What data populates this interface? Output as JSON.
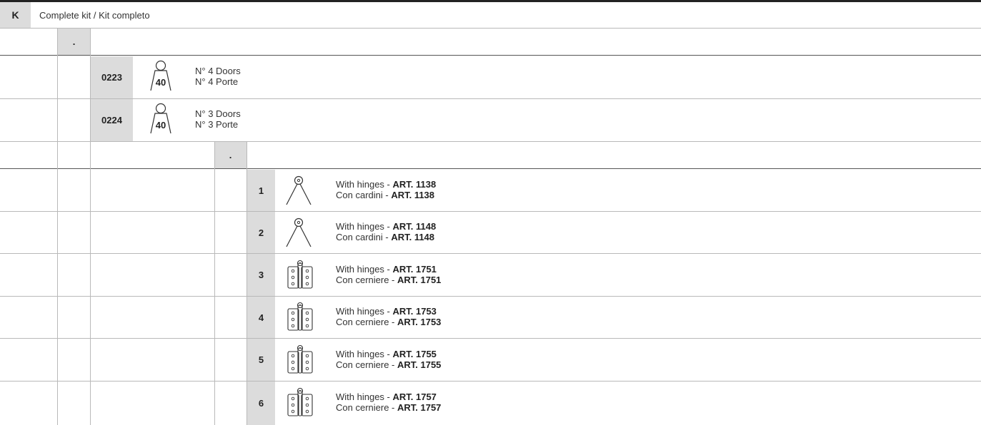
{
  "header": {
    "code": "K",
    "title": "Complete kit / Kit completo"
  },
  "level1": {
    "marker": "."
  },
  "kits": [
    {
      "code": "0223",
      "weight": "40",
      "line1": "N° 4 Doors",
      "line2": "N° 4 Porte",
      "icon": "weight-icon"
    },
    {
      "code": "0224",
      "weight": "40",
      "line1": "N° 3 Doors",
      "line2": "N° 3 Porte",
      "icon": "weight-icon"
    }
  ],
  "level2": {
    "marker": "."
  },
  "options": [
    {
      "num": "1",
      "icon": "compass-hinge-icon",
      "en_text": "With hinges - ",
      "en_art": "ART. 1138",
      "it_text": "Con cardini - ",
      "it_art": "ART. 1138"
    },
    {
      "num": "2",
      "icon": "compass-hinge-icon",
      "en_text": "With hinges - ",
      "en_art": "ART. 1148",
      "it_text": "Con cardini - ",
      "it_art": "ART. 1148"
    },
    {
      "num": "3",
      "icon": "butt-hinge-icon",
      "en_text": "With hinges - ",
      "en_art": "ART. 1751",
      "it_text": "Con cerniere - ",
      "it_art": "ART. 1751"
    },
    {
      "num": "4",
      "icon": "butt-hinge-icon",
      "en_text": "With hinges - ",
      "en_art": "ART. 1753",
      "it_text": "Con cerniere - ",
      "it_art": "ART. 1753"
    },
    {
      "num": "5",
      "icon": "butt-hinge-icon",
      "en_text": "With hinges - ",
      "en_art": "ART. 1755",
      "it_text": "Con cerniere - ",
      "it_art": "ART. 1755"
    },
    {
      "num": "6",
      "icon": "butt-hinge-icon",
      "en_text": "With hinges - ",
      "en_art": "ART. 1757",
      "it_text": "Con cerniere - ",
      "it_art": "ART. 1757"
    }
  ],
  "colors": {
    "cell_gray": "#dcdcdc",
    "rule": "#b9b9b9",
    "top_rule": "#222222"
  }
}
